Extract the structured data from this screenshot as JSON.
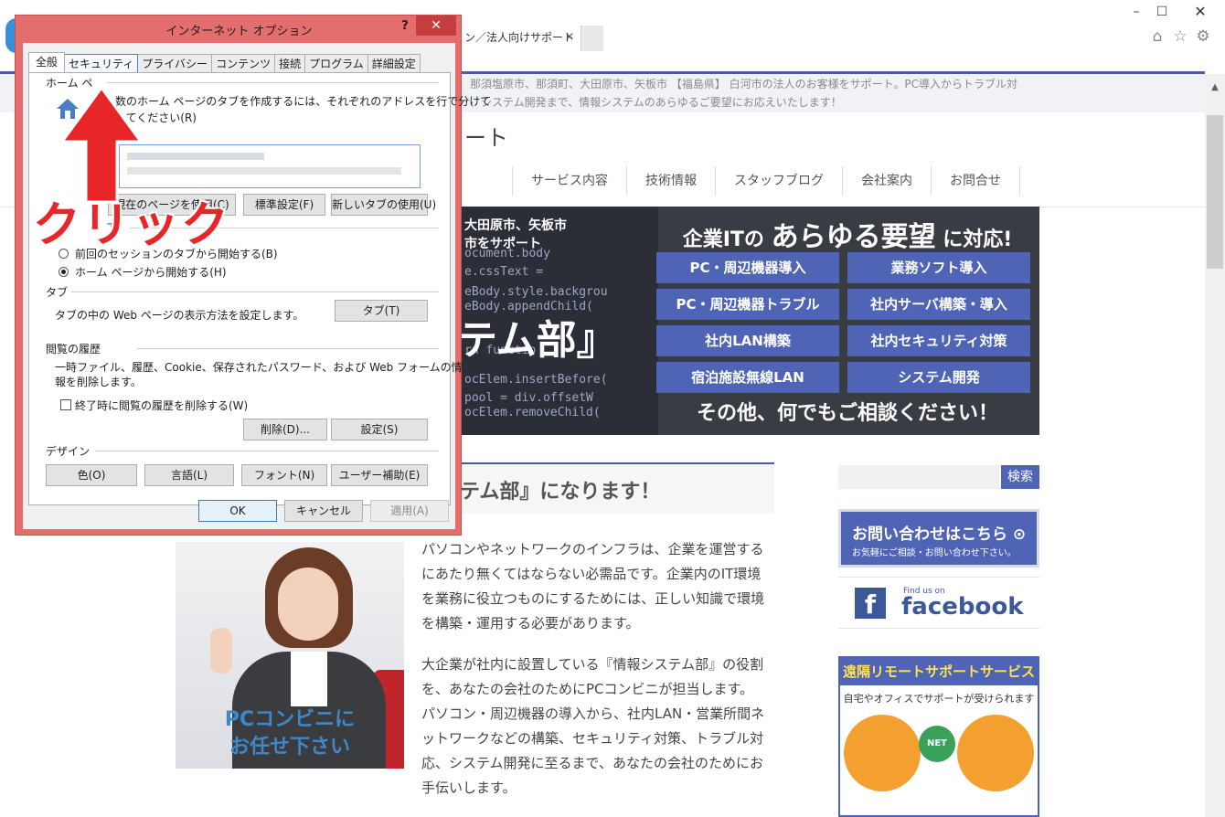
{
  "browser": {
    "tab_label": "ン／法人向けサポート",
    "tab_close": "×",
    "controls": {
      "minimize": "–",
      "maximize": "☐",
      "close": "✕"
    },
    "toolbar_icons": [
      "home-icon",
      "star-icon",
      "gear-icon"
    ]
  },
  "site": {
    "header_desc_1": "那須塩原市、那須町、大田原市、矢板市 【福島県】 白河市の法人のお客様をサポート。PC導入からトラブル対",
    "header_desc_2": "、システム開発まで、情報システムのあらゆるご要望にお応えいたします！",
    "title_fragment": "ート",
    "nav": [
      "サービス内容",
      "技術情報",
      "スタッフブログ",
      "会社案内",
      "お問合せ"
    ],
    "hero": {
      "left_line_1": "大田原市、矢板市",
      "left_line_2": "市をサポート",
      "big_text": "テム部』",
      "code_lines": [
        "ocument.body",
        "e.cssText = ",
        "eBody.style.backgrou",
        "eBody.appendChild(",
        "rn functio",
        "ocElem.insertBefore(",
        "pool = div.offsetW",
        "ocElem.removeChild("
      ],
      "headline_prefix": "企業ITの",
      "headline_big": "あらゆる要望",
      "headline_suffix": "に対応!",
      "services": [
        "PC・周辺機器導入",
        "業務ソフト導入",
        "PC・周辺機器トラブル",
        "社内サーバ構築・導入",
        "社内LAN構築",
        "社内セキュリティ対策",
        "宿泊施設無線LAN",
        "システム開発"
      ],
      "footer": "その他、何でもご相談ください！"
    },
    "content_title": "テム部』になります！",
    "image_caption_1": "PCコンビニに",
    "image_caption_2": "お任せ下さい",
    "paragraph_1": "パソコンやネットワークのインフラは、企業を運営するにあたり無くてはならない必需品です。企業内のIT環境を業務に役立つものにするためには、正しい知識で環境を構築・運用する必要があります。",
    "paragraph_2": "大企業が社内に設置している『情報システム部』の役割を、あなたの会社のためにPCコンビニが担当します。パソコン・周辺機器の導入から、社内LAN・営業所間ネットワークなどの構築、セキュリティ対策、トラブル対応、システム開発に至るまで、あなたの会社のためにお手伝いします。",
    "sidebar": {
      "search_button": "検索",
      "contact_main": "お問い合わせはこちら ⊙",
      "contact_sub": "お気軽にご相談・お問い合わせ下さい。",
      "fb_find": "Find us on",
      "fb_word": "facebook",
      "remote_title": "遠隔リモートサポートサービス",
      "remote_sub": "自宅やオフィスでサポートが受けられます",
      "net_label": "NET"
    }
  },
  "dialog": {
    "title": "インターネット オプション",
    "help": "?",
    "close": "✕",
    "tabs": [
      "全般",
      "セキュリティ",
      "プライバシー",
      "コンテンツ",
      "接続",
      "プログラム",
      "詳細設定"
    ],
    "home_page": {
      "group_label": "ホーム ペ",
      "instruction_1": "数のホーム ページのタブを作成するには、それぞれのアドレスを行で分けて",
      "instruction_2": "してください(R)",
      "btn_current": "現在のページを使用(C)",
      "btn_default": "標準設定(F)",
      "btn_newtab": "新しいタブの使用(U)"
    },
    "startup": {
      "group_label": "ア",
      "option_last": "前回のセッションのタブから開始する(B)",
      "option_home": "ホーム ページから開始する(H)"
    },
    "tabs_group": {
      "label": "タブ",
      "desc": "タブの中の Web ページの表示方法を設定します。",
      "btn": "タブ(T)"
    },
    "history": {
      "label": "閲覧の履歴",
      "desc_1": "一時ファイル、履歴、Cookie、保存されたパスワード、および Web フォームの情",
      "desc_2": "報を削除します。",
      "check_label": "終了時に閲覧の履歴を削除する(W)",
      "btn_delete": "削除(D)...",
      "btn_settings": "設定(S)"
    },
    "design": {
      "label": "デザイン",
      "btn_colors": "色(O)",
      "btn_languages": "言語(L)",
      "btn_fonts": "フォント(N)",
      "btn_accessibility": "ユーザー補助(E)"
    },
    "ok": "OK",
    "cancel": "キャンセル",
    "apply": "適用(A)"
  },
  "annotation": {
    "label": "クリック",
    "color": "#e8262a"
  }
}
